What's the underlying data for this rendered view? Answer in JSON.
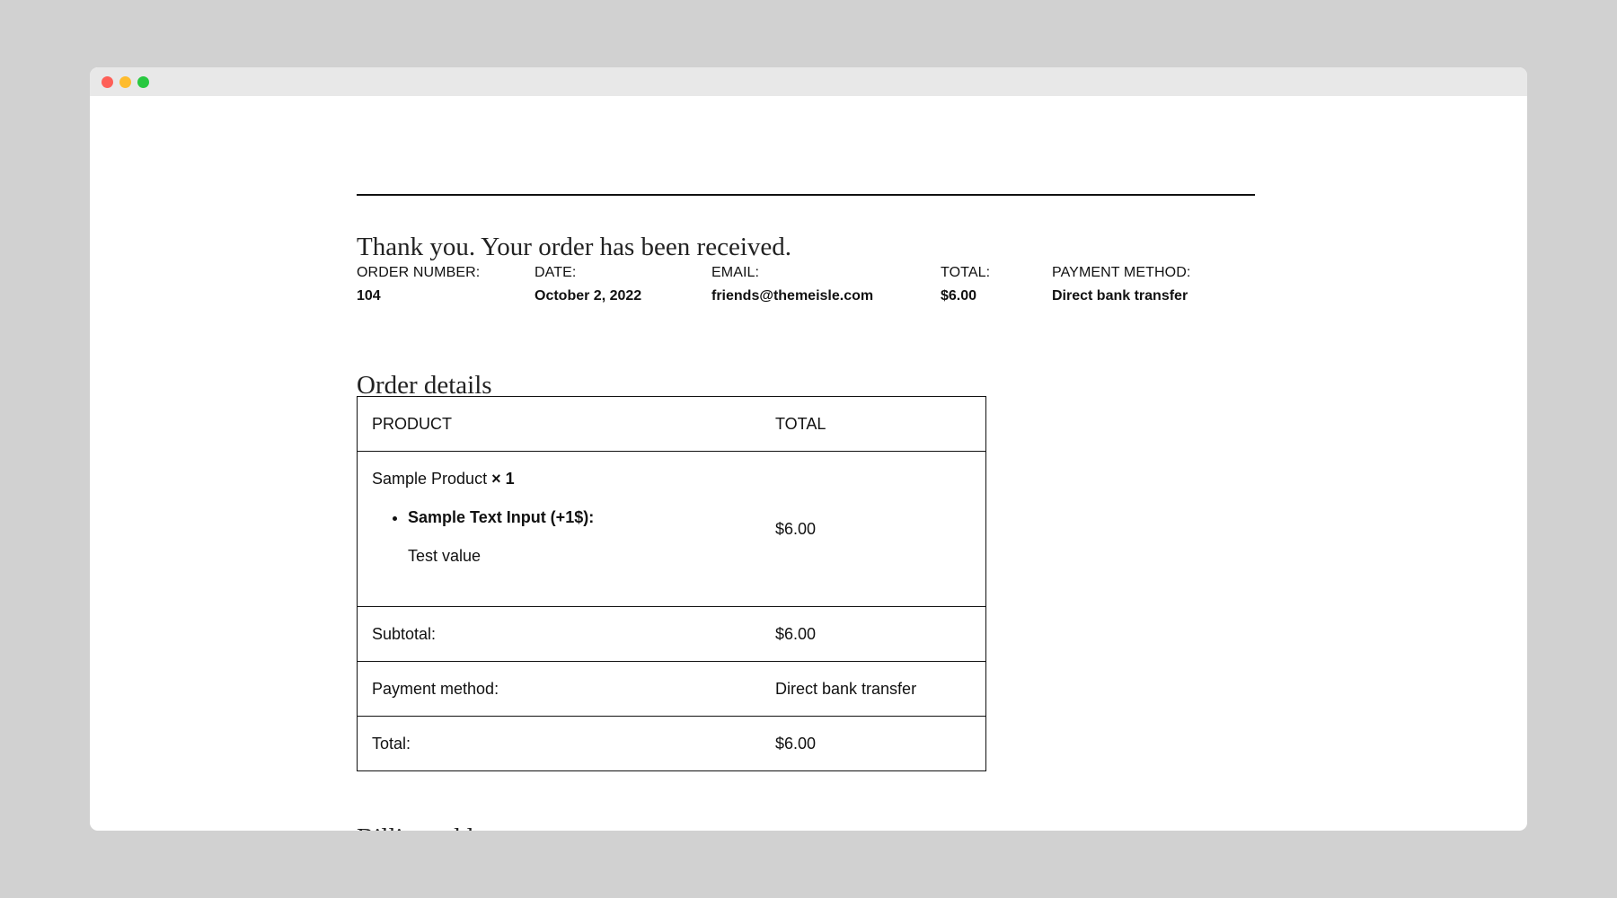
{
  "window_controls": {
    "close_color": "#fe5f57",
    "minimize_color": "#febc2e",
    "maximize_color": "#28c840"
  },
  "thankyou_message": "Thank you. Your order has been received.",
  "overview": {
    "order_number": {
      "label": "ORDER NUMBER:",
      "value": "104"
    },
    "date": {
      "label": "DATE:",
      "value": "October 2, 2022"
    },
    "email": {
      "label": "EMAIL:",
      "value": "friends@themeisle.com"
    },
    "total": {
      "label": "TOTAL:",
      "value": "$6.00"
    },
    "payment_method": {
      "label": "PAYMENT METHOD:",
      "value": "Direct bank transfer"
    }
  },
  "order_details": {
    "title": "Order details",
    "headers": {
      "product": "PRODUCT",
      "total": "TOTAL"
    },
    "item": {
      "name": "Sample Product",
      "quantity": "× 1",
      "meta_key": "Sample Text Input (+1$):",
      "meta_value": "Test value",
      "total": "$6.00"
    },
    "totals": [
      {
        "label": "Subtotal:",
        "value": "$6.00"
      },
      {
        "label": "Payment method:",
        "value": "Direct bank transfer"
      },
      {
        "label": "Total:",
        "value": "$6.00"
      }
    ]
  },
  "billing": {
    "title": "Billing address"
  }
}
